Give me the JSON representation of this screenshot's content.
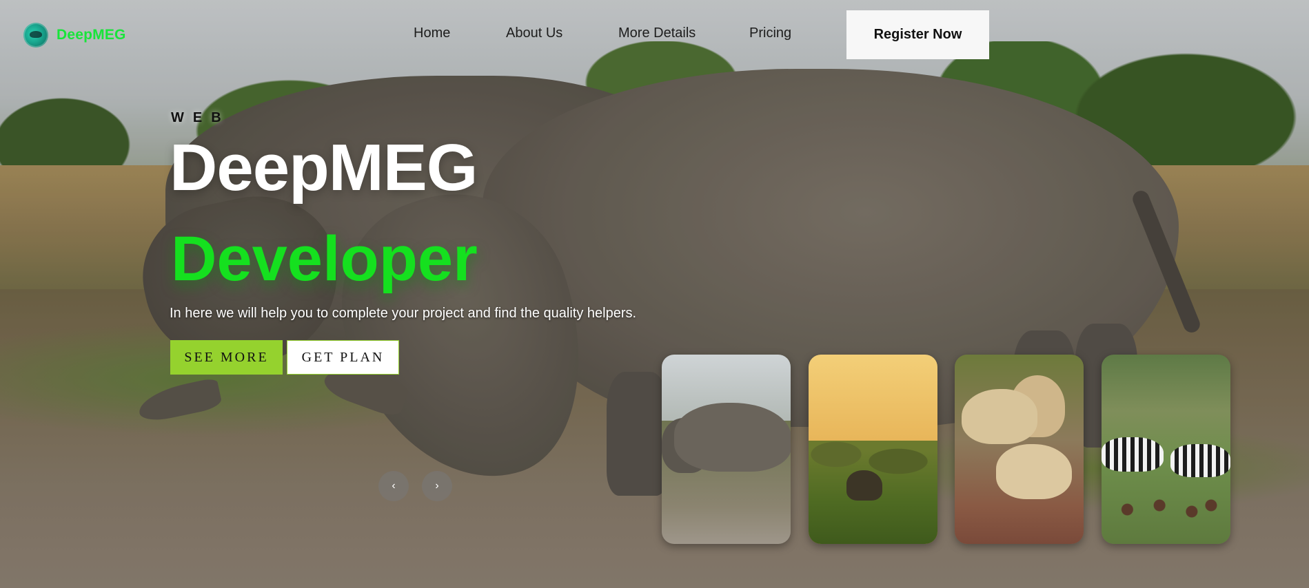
{
  "brand": {
    "name": "DeepMEG",
    "logo_icon": "shark-logo-icon"
  },
  "nav": {
    "items": [
      {
        "label": "Home"
      },
      {
        "label": "About Us"
      },
      {
        "label": "More Details"
      },
      {
        "label": "Pricing"
      }
    ],
    "cta_label": "Register Now"
  },
  "hero": {
    "eyebrow": "WEB",
    "title": "DeepMEG",
    "subtitle": "Developer",
    "tagline": "In here we will help you to complete your project and find the quality helpers.",
    "buttons": {
      "see_more": "SEE MORE",
      "get_plan": "GET PLAN"
    },
    "carousel": {
      "prev_icon": "‹",
      "next_icon": "›"
    }
  },
  "colors": {
    "brand_green": "#18e53a",
    "accent_lime": "#95d22e",
    "subtitle_green": "#15e01f"
  }
}
